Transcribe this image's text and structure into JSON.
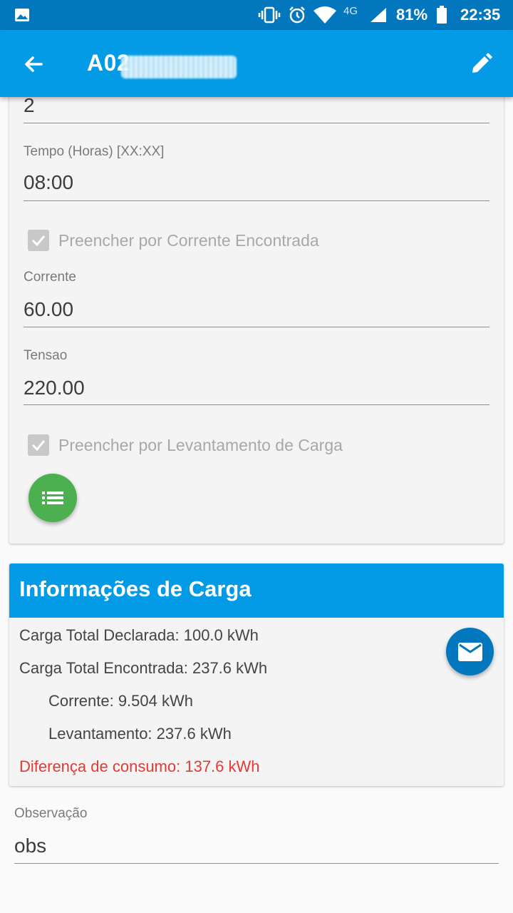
{
  "status_bar": {
    "battery": "81%",
    "time": "22:35",
    "network": "4G",
    "icons": [
      "image-icon",
      "vibrate-icon",
      "alarm-icon",
      "wifi-icon",
      "signal-icon",
      "battery-icon"
    ]
  },
  "app_bar": {
    "title": "A02",
    "back_icon": "arrow-back-icon",
    "edit_icon": "pencil-icon",
    "color": "#039be5"
  },
  "form": {
    "top_value": "2",
    "tempo": {
      "label": "Tempo (Horas) [XX:XX]",
      "value": "08:00"
    },
    "check_corrente": {
      "label": "Preencher por Corrente Encontrada",
      "checked": true,
      "disabled": true
    },
    "corrente": {
      "label": "Corrente",
      "value": "60.00"
    },
    "tensao": {
      "label": "Tensao",
      "value": "220.00"
    },
    "check_levantamento": {
      "label": "Preencher por Levantamento de Carga",
      "checked": true,
      "disabled": true
    },
    "list_fab_icon": "list-icon",
    "list_fab_color": "#4caf50"
  },
  "carga": {
    "title": "Informações de Carga",
    "declarada": "Carga Total Declarada: 100.0 kWh",
    "encontrada": "Carga Total Encontrada: 237.6 kWh",
    "corrente": "Corrente: 9.504 kWh",
    "levantamento": "Levantamento: 237.6 kWh",
    "diferenca": "Diferença de consumo: 137.6 kWh",
    "diferenca_color": "#e53935",
    "mail_fab_icon": "mail-icon"
  },
  "observacao": {
    "label": "Observação",
    "value": "obs"
  }
}
